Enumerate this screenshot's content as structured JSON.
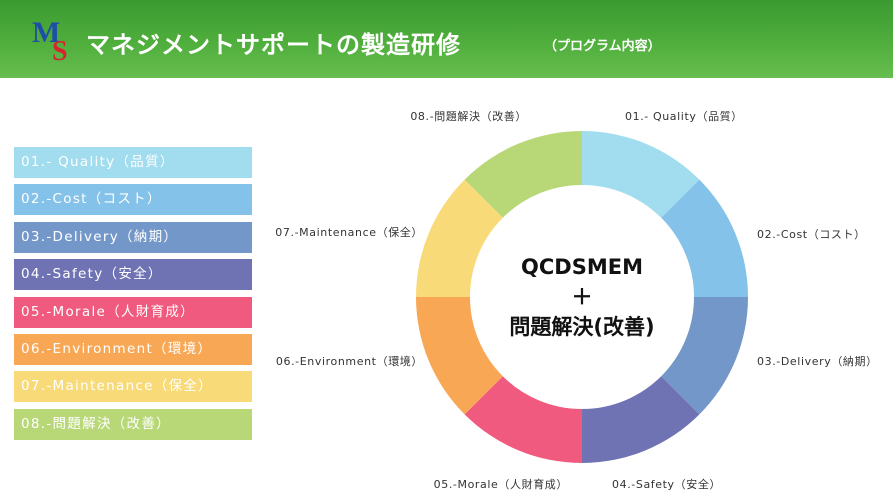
{
  "header": {
    "logo_m": "M",
    "logo_s": "S",
    "title": "マネジメントサポートの製造研修",
    "subtitle": "（プログラム内容）"
  },
  "legend": {
    "items": [
      {
        "label": "01.- Quality（品質）",
        "color": "#a1dcef"
      },
      {
        "label": "02.-Cost（コスト）",
        "color": "#85c2e9"
      },
      {
        "label": "03.-Delivery（納期）",
        "color": "#7497c9"
      },
      {
        "label": "04.-Safety（安全）",
        "color": "#6f73b4"
      },
      {
        "label": "05.-Morale（人財育成）",
        "color": "#f05a7e"
      },
      {
        "label": "06.-Environment（環境）",
        "color": "#f8a755"
      },
      {
        "label": "07.-Maintenance（保全）",
        "color": "#f9da78"
      },
      {
        "label": "08.-問題解決（改善）",
        "color": "#b8d878"
      }
    ]
  },
  "donut": {
    "center_line1": "QCDSMEM",
    "center_line2": "＋",
    "center_line3": "問題解決(改善)",
    "segments": [
      {
        "label": "01.- Quality（品質）",
        "color": "#a1dcef",
        "value": 1
      },
      {
        "label": "02.-Cost（コスト）",
        "color": "#85c2e9",
        "value": 1
      },
      {
        "label": "03.-Delivery（納期）",
        "color": "#7497c9",
        "value": 1
      },
      {
        "label": "04.-Safety（安全）",
        "color": "#6f73b4",
        "value": 1
      },
      {
        "label": "05.-Morale（人財育成）",
        "color": "#f05a7e",
        "value": 1
      },
      {
        "label": "06.-Environment（環境）",
        "color": "#f8a755",
        "value": 1
      },
      {
        "label": "07.-Maintenance（保全）",
        "color": "#f9da78",
        "value": 1
      },
      {
        "label": "08.-問題解決（改善）",
        "color": "#b8d878",
        "value": 1
      }
    ]
  }
}
